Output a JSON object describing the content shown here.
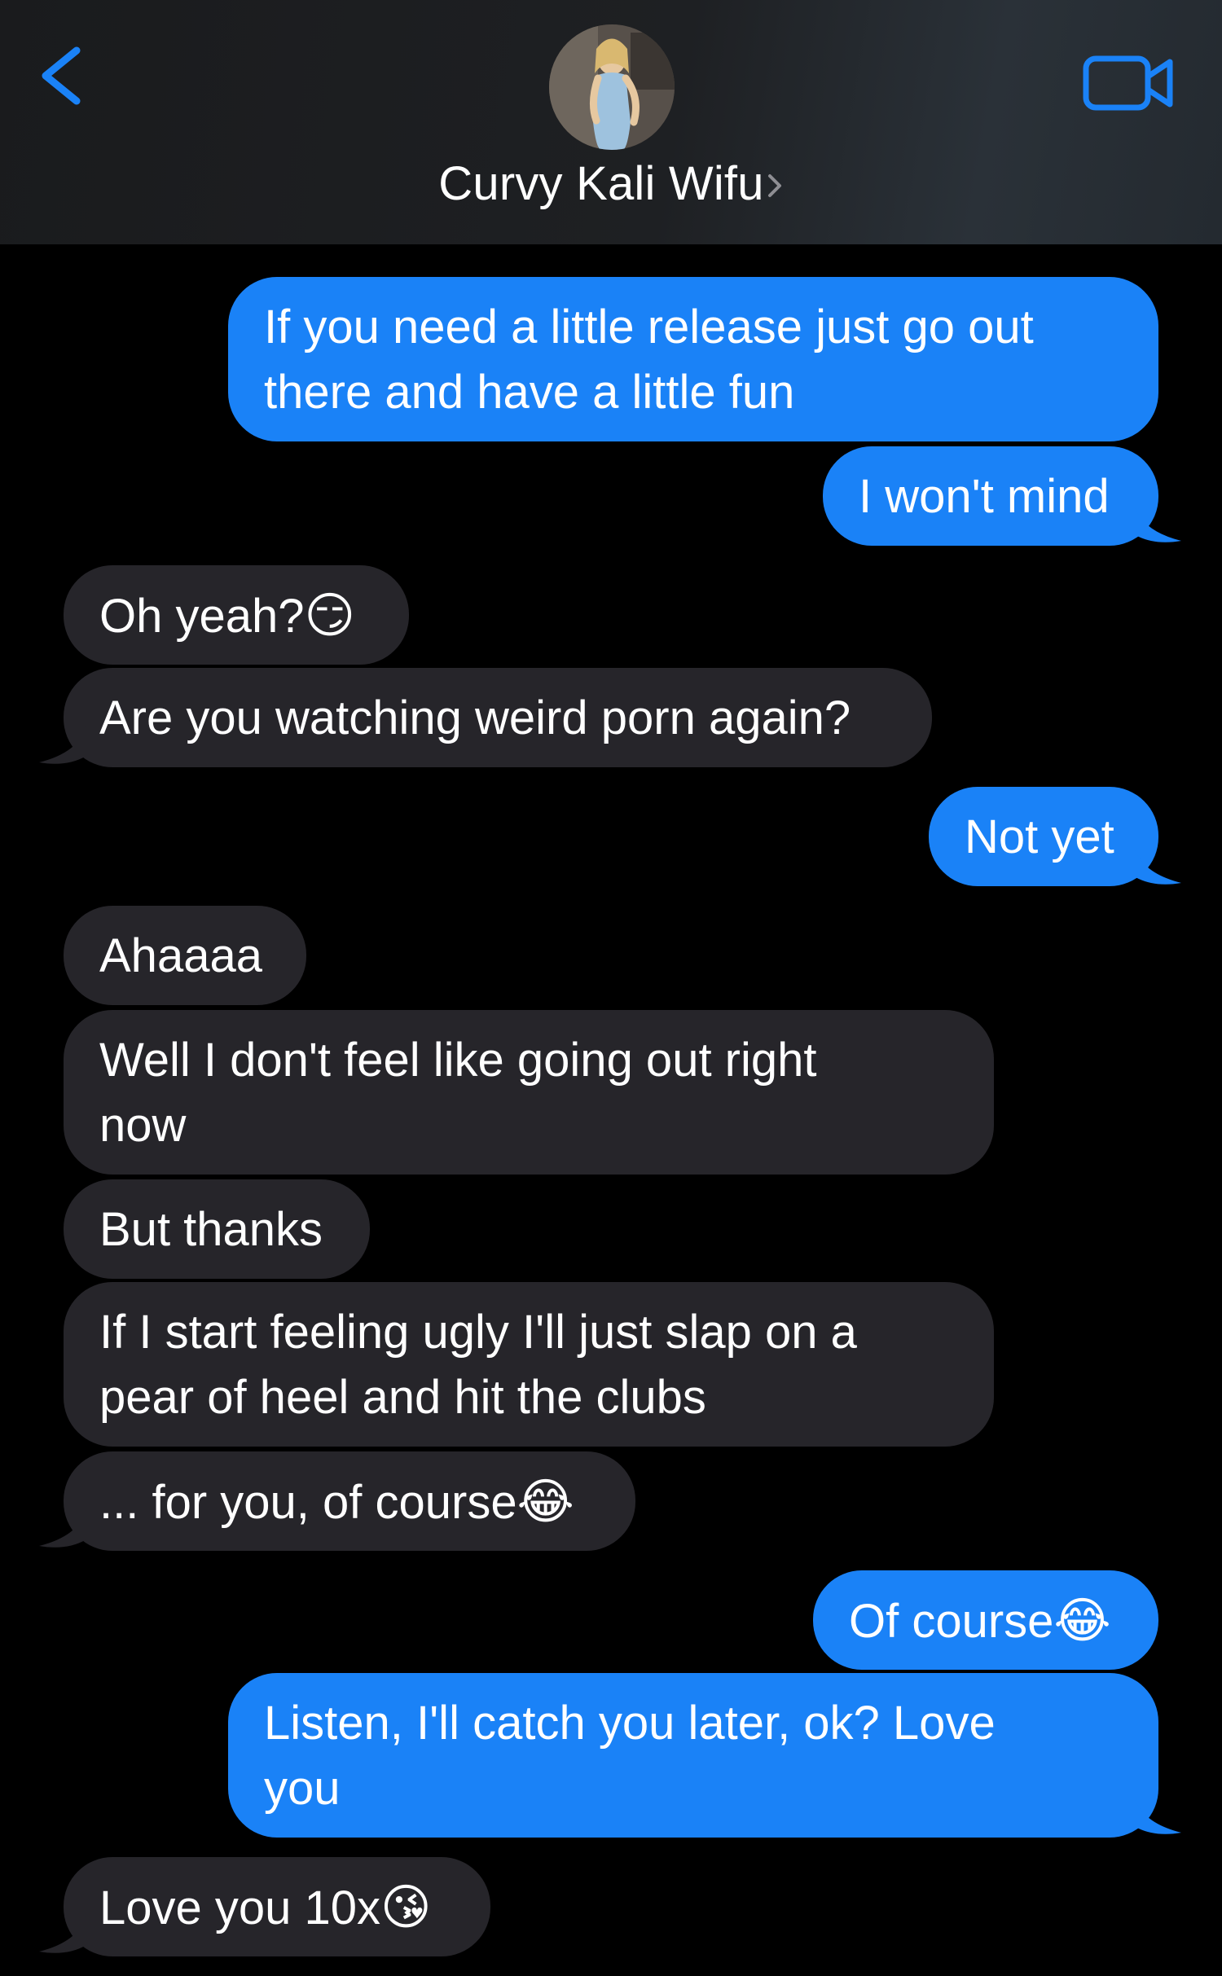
{
  "header": {
    "contact_name": "Curvy Kali Wifu",
    "icons": {
      "back": "chevron-left-icon",
      "video": "video-camera-icon",
      "details": "chevron-right-icon"
    },
    "accent_color": "#1a82f7"
  },
  "colors": {
    "sent_bubble": "#1a82f7",
    "received_bubble": "#26252a",
    "background": "#000000"
  },
  "messages": [
    {
      "direction": "sent",
      "lines": [
        "If you need a little release just go out",
        "there and have a little fun"
      ],
      "emoji": ""
    },
    {
      "direction": "sent",
      "lines": [
        "I won't mind"
      ],
      "emoji": ""
    },
    {
      "direction": "received",
      "lines": [
        "Oh yeah?"
      ],
      "emoji": "😏"
    },
    {
      "direction": "received",
      "lines": [
        "Are you watching weird porn again?"
      ],
      "emoji": ""
    },
    {
      "direction": "sent",
      "lines": [
        "Not yet"
      ],
      "emoji": ""
    },
    {
      "direction": "received",
      "lines": [
        "Ahaaaa"
      ],
      "emoji": ""
    },
    {
      "direction": "received",
      "lines": [
        "Well I don't feel like going out right",
        "now"
      ],
      "emoji": ""
    },
    {
      "direction": "received",
      "lines": [
        "But thanks"
      ],
      "emoji": ""
    },
    {
      "direction": "received",
      "lines": [
        "If I start feeling ugly I'll just slap on a",
        "pear of heel and hit the clubs"
      ],
      "emoji": ""
    },
    {
      "direction": "received",
      "lines": [
        "... for you, of course"
      ],
      "emoji": "😂"
    },
    {
      "direction": "sent",
      "lines": [
        "Of course"
      ],
      "emoji": "😂"
    },
    {
      "direction": "sent",
      "lines": [
        "Listen, I'll catch you later, ok? Love",
        "you"
      ],
      "emoji": ""
    },
    {
      "direction": "received",
      "lines": [
        "Love you 10x"
      ],
      "emoji": "😘"
    }
  ]
}
